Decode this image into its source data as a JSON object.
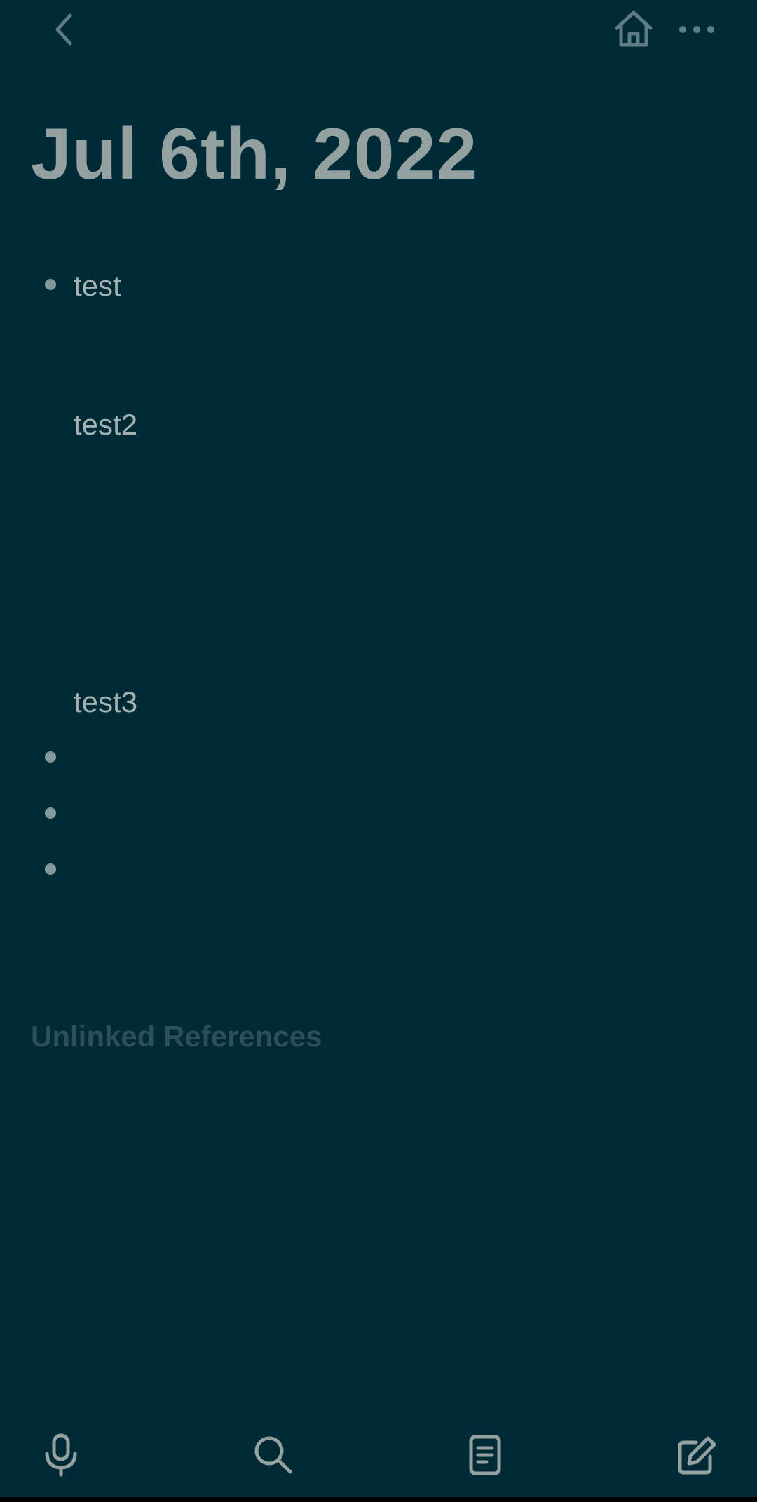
{
  "header": {
    "icons": [
      "chevron-left-icon",
      "home-icon",
      "more-horizontal-icon"
    ]
  },
  "page": {
    "title": "Jul 6th, 2022"
  },
  "blocks": [
    {
      "text": "test",
      "bulleted": true
    },
    {
      "text": "test2",
      "bulleted": false
    },
    {
      "text": "test3",
      "bulleted": false
    },
    {
      "text": "",
      "bulleted": true
    },
    {
      "text": "",
      "bulleted": true
    },
    {
      "text": "",
      "bulleted": true
    }
  ],
  "references": {
    "unlinked_label": "Unlinked References"
  },
  "toolbar": {
    "icons": [
      "microphone-icon",
      "search-icon",
      "page-icon",
      "compose-icon"
    ]
  },
  "colors": {
    "background": "#002a35",
    "text": "#93a1a1",
    "icon": "#5d7c85",
    "muted": "#2d4f5a"
  }
}
